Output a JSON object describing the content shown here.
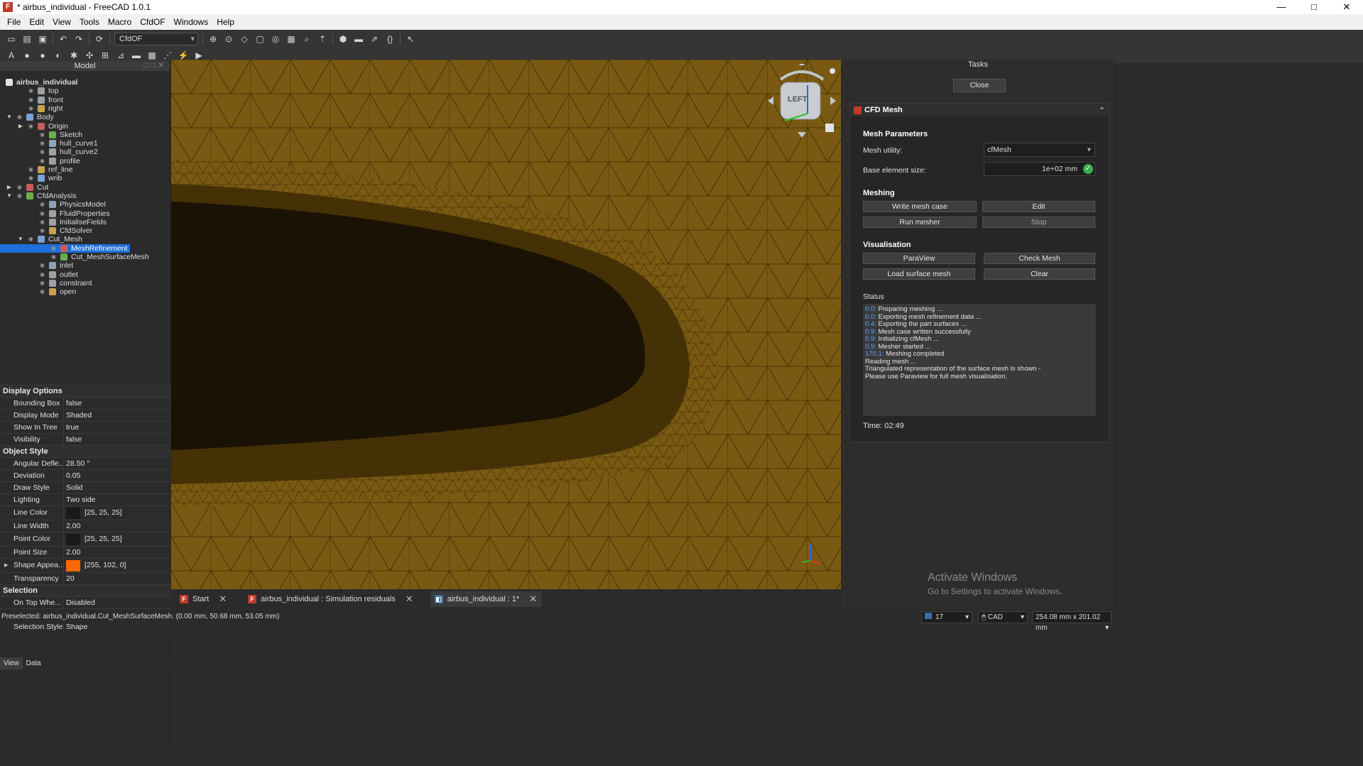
{
  "window": {
    "title": "* airbus_individual - FreeCAD 1.0.1",
    "controls": [
      "—",
      "□",
      "✕"
    ]
  },
  "menu": [
    "File",
    "Edit",
    "View",
    "Tools",
    "Macro",
    "CfdOF",
    "Windows",
    "Help"
  ],
  "toolbar": {
    "workbench": "CfdOF"
  },
  "model_panel": {
    "title": "Model",
    "tree": [
      {
        "label": "airbus_individual",
        "depth": 0,
        "expanded": true,
        "root": true
      },
      {
        "label": "top",
        "depth": 2
      },
      {
        "label": "front",
        "depth": 2
      },
      {
        "label": "right",
        "depth": 2
      },
      {
        "label": "Body",
        "depth": 1,
        "expanded": true
      },
      {
        "label": "Origin",
        "depth": 2,
        "collapsed": true
      },
      {
        "label": "Sketch",
        "depth": 3
      },
      {
        "label": "hull_curve1",
        "depth": 3
      },
      {
        "label": "hull_curve2",
        "depth": 3
      },
      {
        "label": "profile",
        "depth": 3
      },
      {
        "label": "ref_line",
        "depth": 2
      },
      {
        "label": "wrib",
        "depth": 2
      },
      {
        "label": "Cut",
        "depth": 1,
        "collapsed": true
      },
      {
        "label": "CfdAnalysis",
        "depth": 1,
        "expanded": true
      },
      {
        "label": "PhysicsModel",
        "depth": 3
      },
      {
        "label": "FluidProperties",
        "depth": 3
      },
      {
        "label": "InitialiseFields",
        "depth": 3
      },
      {
        "label": "CfdSolver",
        "depth": 3
      },
      {
        "label": "Cut_Mesh",
        "depth": 2,
        "expanded": true
      },
      {
        "label": "MeshRefinement",
        "depth": 4,
        "selected": true
      },
      {
        "label": "Cut_MeshSurfaceMesh",
        "depth": 4
      },
      {
        "label": "inlet",
        "depth": 3
      },
      {
        "label": "outlet",
        "depth": 3
      },
      {
        "label": "constraint",
        "depth": 3
      },
      {
        "label": "open",
        "depth": 3
      }
    ]
  },
  "properties": [
    {
      "group": "Display Options",
      "rows": [
        {
          "k": "Bounding Box",
          "v": "false"
        },
        {
          "k": "Display Mode",
          "v": "Shaded"
        },
        {
          "k": "Show In Tree",
          "v": "true"
        },
        {
          "k": "Visibility",
          "v": "false"
        }
      ]
    },
    {
      "group": "Object Style",
      "rows": [
        {
          "k": "Angular Defle...",
          "v": "28.50 °"
        },
        {
          "k": "Deviation",
          "v": "0.05"
        },
        {
          "k": "Draw Style",
          "v": "Solid"
        },
        {
          "k": "Lighting",
          "v": "Two side"
        },
        {
          "k": "Line Color",
          "v": "[25, 25, 25]",
          "swatch": "#191919"
        },
        {
          "k": "Line Width",
          "v": "2.00"
        },
        {
          "k": "Point Color",
          "v": "[25, 25, 25]",
          "swatch": "#191919"
        },
        {
          "k": "Point Size",
          "v": "2.00"
        },
        {
          "k": "Shape Appea...",
          "v": "[255, 102, 0]",
          "swatch": "#ff6600",
          "expandable": true
        },
        {
          "k": "Transparency",
          "v": "20"
        }
      ]
    },
    {
      "group": "Selection",
      "rows": [
        {
          "k": "On Top Whe...",
          "v": "Disabled"
        },
        {
          "k": "Selectable",
          "v": "true"
        },
        {
          "k": "Selection Style",
          "v": "Shape"
        }
      ]
    }
  ],
  "left_tabs": [
    "View",
    "Data"
  ],
  "navcube": {
    "face": "LEFT"
  },
  "doc_tabs": [
    {
      "label": "Start"
    },
    {
      "label": "airbus_individual : Simulation residuals"
    },
    {
      "label": "airbus_individual : 1*",
      "active": true
    }
  ],
  "tasks": {
    "title": "Tasks",
    "close": "Close",
    "panel_title": "CFD Mesh",
    "mesh_parameters": "Mesh Parameters",
    "mesh_utility_label": "Mesh utility:",
    "mesh_utility_value": "cfMesh",
    "base_size_label": "Base element size:",
    "base_size_value": "1e+02 mm",
    "meshing": "Meshing",
    "write_mesh_case": "Write mesh case",
    "edit": "Edit",
    "run_mesher": "Run mesher",
    "stop": "Stop",
    "visualisation": "Visualisation",
    "paraview": "ParaView",
    "check_mesh": "Check Mesh",
    "load_surface_mesh": "Load surface mesh",
    "clear": "Clear",
    "status_label": "Status",
    "status_lines": [
      {
        "t": "0.0:",
        "msg": "Preparing meshing ..."
      },
      {
        "t": "0.0:",
        "msg": "Exporting mesh refinement data ..."
      },
      {
        "t": "0.4:",
        "msg": "Exporting the part surfaces ..."
      },
      {
        "t": "0.9:",
        "msg": "Mesh case written successfully"
      },
      {
        "t": "0.9:",
        "msg": "Initializing cfMesh ..."
      },
      {
        "t": "0.9:",
        "msg": "Mesher started ..."
      },
      {
        "t": "170.1:",
        "msg": "Meshing completed"
      },
      {
        "t": "",
        "msg": "Reading mesh ..."
      },
      {
        "t": "",
        "msg": "Triangulated representation of the surface mesh is shown -"
      },
      {
        "t": "",
        "msg": "Please use Paraview for full mesh visualisation."
      }
    ],
    "time": "Time: 02:49"
  },
  "watermark": {
    "line1": "Activate Windows",
    "line2": "Go to Settings to activate Windows."
  },
  "statusbar": {
    "text": "Preselected: airbus_individual.Cut_MeshSurfaceMesh. (0.00 mm, 50.68 mm, 53.05 mm)",
    "count": "17",
    "nav": "CAD",
    "dims": "254.08 mm x 201.02 mm"
  },
  "colors": {
    "mesh_fill": "#7a5a12",
    "mesh_line": "#3a2a05",
    "selection": "#1e6fd8",
    "accent_time": "#5ea0ff"
  }
}
